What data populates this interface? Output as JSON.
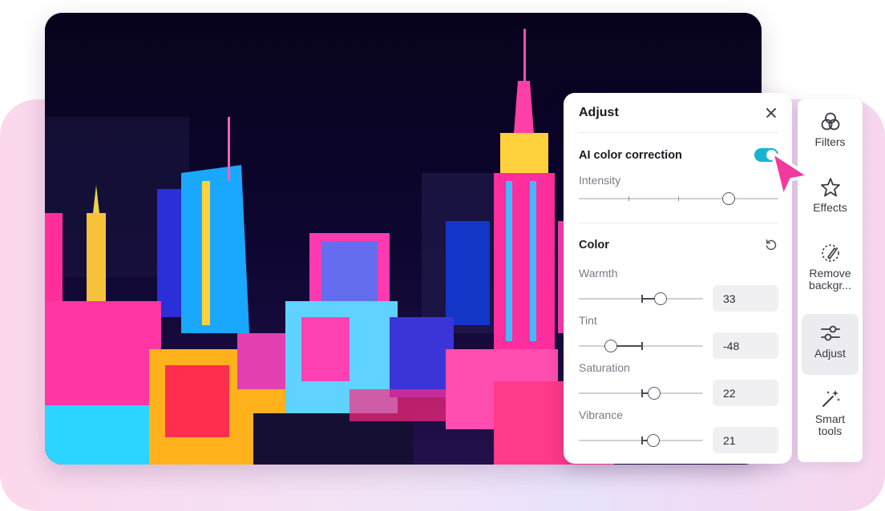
{
  "panel": {
    "title": "Adjust",
    "ai_correction": {
      "label": "AI color correction",
      "enabled": true,
      "intensity_label": "Intensity",
      "intensity": 0.83
    },
    "color": {
      "title": "Color",
      "sliders": [
        {
          "label": "Warmth",
          "value": "33"
        },
        {
          "label": "Tint",
          "value": "-48"
        },
        {
          "label": "Saturation",
          "value": "22"
        },
        {
          "label": "Vibrance",
          "value": "21"
        }
      ]
    }
  },
  "toolbar": {
    "items": [
      {
        "label": "Filters",
        "icon": "filters-icon"
      },
      {
        "label": "Effects",
        "icon": "effects-icon"
      },
      {
        "label": "Remove backgr...",
        "icon": "remove-background-icon"
      },
      {
        "label": "Adjust",
        "icon": "adjust-icon"
      },
      {
        "label": "Smart tools",
        "icon": "smart-tools-icon"
      }
    ]
  },
  "colors": {
    "accent": "#17b4d0",
    "cursor": "#f23a9e"
  }
}
